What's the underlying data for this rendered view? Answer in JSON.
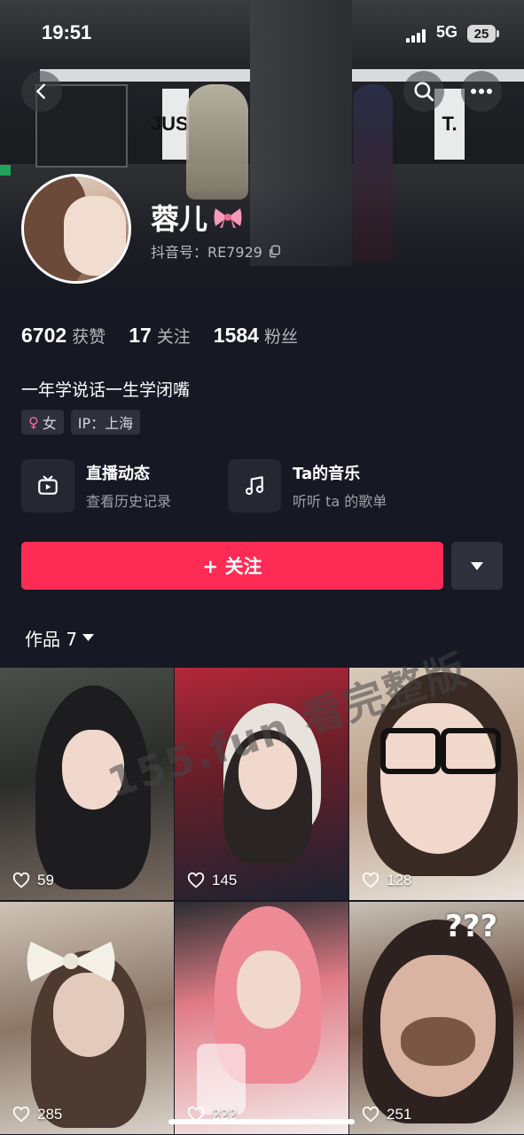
{
  "status": {
    "time": "19:51",
    "network": "5G",
    "battery": "25"
  },
  "header": {
    "back_icon": "chevron-left-icon",
    "search_icon": "search-icon",
    "more_icon": "more-dots-icon",
    "cover_sign_left": "JUST",
    "cover_sign_right": "T."
  },
  "profile": {
    "nickname": "蓉儿",
    "bow_emoji": "🎀",
    "douyin_id": "抖音号：RE7929",
    "stats": [
      {
        "value": "6702",
        "label": "获赞"
      },
      {
        "value": "17",
        "label": "关注"
      },
      {
        "value": "1584",
        "label": "粉丝"
      }
    ],
    "bio": "一年学说话一生学闭嘴",
    "gender_tag": "女",
    "ip_tag": "IP：上海"
  },
  "entries": {
    "live": {
      "title": "直播动态",
      "subtitle": "查看历史记录",
      "icon": "tv-icon"
    },
    "music": {
      "title": "Ta的音乐",
      "subtitle": "听听 ta 的歌单",
      "icon": "music-note-icon"
    }
  },
  "actions": {
    "follow_label": "+ 关注",
    "dropdown_icon": "caret-down-icon"
  },
  "works_tab": {
    "label": "作品 7"
  },
  "videos": [
    {
      "likes": "59"
    },
    {
      "likes": "145"
    },
    {
      "likes": "128"
    },
    {
      "likes": "285"
    },
    {
      "likes": "222"
    },
    {
      "likes": "251"
    }
  ],
  "watermark": "155.fun 看完整版",
  "colors": {
    "accent": "#fe2c55",
    "background": "#161823",
    "chip": "#2e303b"
  }
}
